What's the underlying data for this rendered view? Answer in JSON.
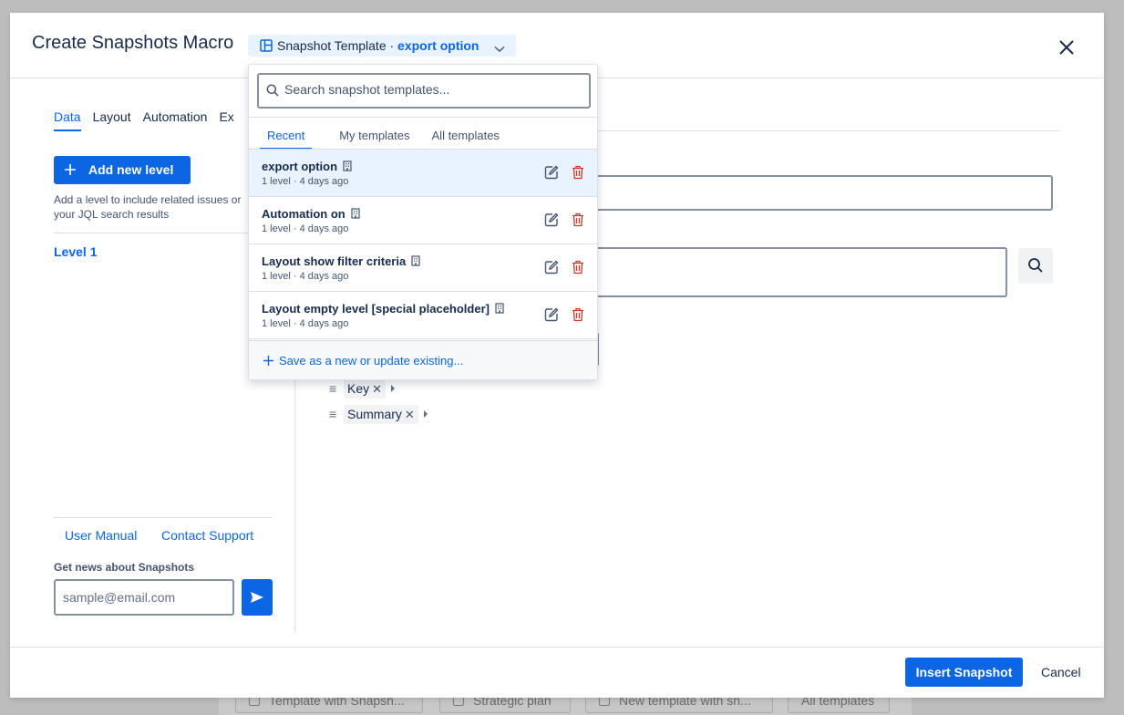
{
  "background": {
    "buttons": [
      "Template with Snapsh...",
      "Strategic plan",
      "New template with sn...",
      "All templates"
    ]
  },
  "modal": {
    "title": "Create Snapshots Macro",
    "template_chip": {
      "prefix": "Snapshot Template · ",
      "selected": "export option"
    },
    "close_icon": "close-icon"
  },
  "left_panel": {
    "tabs": [
      "Data",
      "Layout",
      "Automation",
      "Ex"
    ],
    "active_tab": "Data",
    "add_level_label": "Add new level",
    "add_level_hint": "Add a level to include related issues or your JQL search results",
    "levels": [
      "Level 1"
    ],
    "user_manual": "User Manual",
    "contact_support": "Contact Support",
    "news_label": "Get news about Snapshots",
    "email_placeholder": "sample@email.com"
  },
  "columns": [
    {
      "label": "Key"
    },
    {
      "label": "Summary"
    }
  ],
  "dropdown": {
    "search_placeholder": "Search snapshot templates...",
    "tabs": [
      "Recent",
      "My templates",
      "All templates"
    ],
    "active_tab": "Recent",
    "items": [
      {
        "name": "export option",
        "meta": "1 level · 4 days ago",
        "selected": true
      },
      {
        "name": "Automation on",
        "meta": "1 level · 4 days ago",
        "selected": false
      },
      {
        "name": "Layout show filter criteria",
        "meta": "1 level · 4 days ago",
        "selected": false
      },
      {
        "name": "Layout empty level [special placeholder]",
        "meta": "1 level · 4 days ago",
        "selected": false
      }
    ],
    "save_label": "Save as a new or update existing..."
  },
  "footer": {
    "insert_label": "Insert Snapshot",
    "cancel_label": "Cancel"
  },
  "colors": {
    "primary": "#0c66e4",
    "danger": "#c9372c",
    "selected_bg": "#e9f2ff"
  }
}
